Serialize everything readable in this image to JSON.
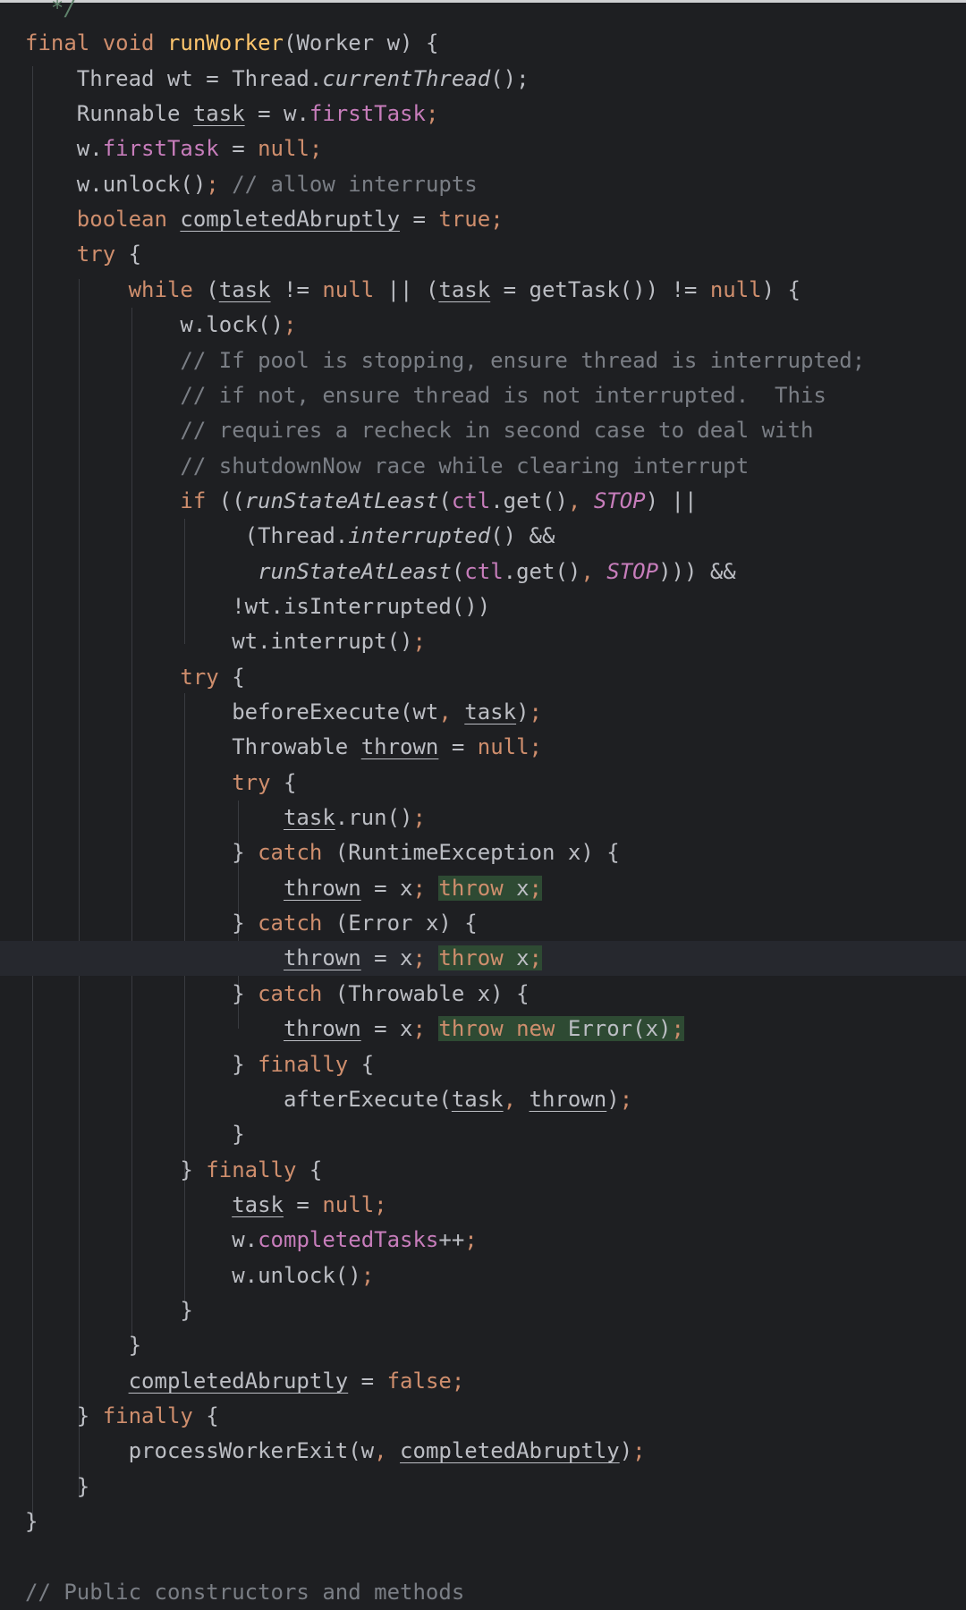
{
  "editor": {
    "lines": [
      [
        {
          "t": "  ",
          "c": ""
        },
        {
          "t": "*/",
          "c": "doc"
        }
      ],
      [
        {
          "t": "final void ",
          "c": "kw"
        },
        {
          "t": "runWorker",
          "c": "mth"
        },
        {
          "t": "(Worker w) {",
          "c": ""
        }
      ],
      [
        {
          "t": "    Thread wt = Thread.",
          "c": ""
        },
        {
          "t": "currentThread",
          "c": "ital"
        },
        {
          "t": "();",
          "c": ""
        }
      ],
      [
        {
          "t": "    Runnable ",
          "c": ""
        },
        {
          "t": "task",
          "c": "var"
        },
        {
          "t": " = w.",
          "c": ""
        },
        {
          "t": "firstTask",
          "c": "fld"
        },
        {
          "t": ";",
          "c": "punc"
        }
      ],
      [
        {
          "t": "    w.",
          "c": ""
        },
        {
          "t": "firstTask",
          "c": "fld"
        },
        {
          "t": " = ",
          "c": ""
        },
        {
          "t": "null",
          "c": "kw"
        },
        {
          "t": ";",
          "c": "punc"
        }
      ],
      [
        {
          "t": "    w.unlock()",
          "c": ""
        },
        {
          "t": ";",
          "c": "punc"
        },
        {
          "t": " // allow interrupts",
          "c": "cmt"
        }
      ],
      [
        {
          "t": "    ",
          "c": ""
        },
        {
          "t": "boolean ",
          "c": "kw"
        },
        {
          "t": "completedAbruptly",
          "c": "var"
        },
        {
          "t": " = ",
          "c": ""
        },
        {
          "t": "true",
          "c": "kw"
        },
        {
          "t": ";",
          "c": "punc"
        }
      ],
      [
        {
          "t": "    ",
          "c": ""
        },
        {
          "t": "try",
          "c": "kw"
        },
        {
          "t": " {",
          "c": ""
        }
      ],
      [
        {
          "t": "        ",
          "c": ""
        },
        {
          "t": "while",
          "c": "kw"
        },
        {
          "t": " (",
          "c": ""
        },
        {
          "t": "task",
          "c": "var"
        },
        {
          "t": " != ",
          "c": ""
        },
        {
          "t": "null",
          "c": "kw"
        },
        {
          "t": " || (",
          "c": ""
        },
        {
          "t": "task",
          "c": "var"
        },
        {
          "t": " = getTask()) != ",
          "c": ""
        },
        {
          "t": "null",
          "c": "kw"
        },
        {
          "t": ") {",
          "c": ""
        }
      ],
      [
        {
          "t": "            w.lock()",
          "c": ""
        },
        {
          "t": ";",
          "c": "punc"
        }
      ],
      [
        {
          "t": "            // If pool is stopping, ensure thread is interrupted;",
          "c": "cmt"
        }
      ],
      [
        {
          "t": "            // if not, ensure thread is not interrupted.  This",
          "c": "cmt"
        }
      ],
      [
        {
          "t": "            // requires a recheck in second case to deal with",
          "c": "cmt"
        }
      ],
      [
        {
          "t": "            // shutdownNow race while clearing interrupt",
          "c": "cmt"
        }
      ],
      [
        {
          "t": "            ",
          "c": ""
        },
        {
          "t": "if",
          "c": "kw"
        },
        {
          "t": " ((",
          "c": ""
        },
        {
          "t": "runStateAtLeast",
          "c": "ital"
        },
        {
          "t": "(",
          "c": ""
        },
        {
          "t": "ctl",
          "c": "fld"
        },
        {
          "t": ".get()",
          "c": ""
        },
        {
          "t": ", ",
          "c": "punc"
        },
        {
          "t": "STOP",
          "c": "fld ital"
        },
        {
          "t": ") ||",
          "c": ""
        }
      ],
      [
        {
          "t": "                 (Thread.",
          "c": ""
        },
        {
          "t": "interrupted",
          "c": "ital"
        },
        {
          "t": "() &&",
          "c": ""
        }
      ],
      [
        {
          "t": "                  ",
          "c": ""
        },
        {
          "t": "runStateAtLeast",
          "c": "ital"
        },
        {
          "t": "(",
          "c": ""
        },
        {
          "t": "ctl",
          "c": "fld"
        },
        {
          "t": ".get()",
          "c": ""
        },
        {
          "t": ", ",
          "c": "punc"
        },
        {
          "t": "STOP",
          "c": "fld ital"
        },
        {
          "t": "))) &&",
          "c": ""
        }
      ],
      [
        {
          "t": "                !wt.isInterrupted())",
          "c": ""
        }
      ],
      [
        {
          "t": "                wt.interrupt()",
          "c": ""
        },
        {
          "t": ";",
          "c": "punc"
        }
      ],
      [
        {
          "t": "            ",
          "c": ""
        },
        {
          "t": "try",
          "c": "kw"
        },
        {
          "t": " {",
          "c": ""
        }
      ],
      [
        {
          "t": "                beforeExecute(wt",
          "c": ""
        },
        {
          "t": ", ",
          "c": "punc"
        },
        {
          "t": "task",
          "c": "var"
        },
        {
          "t": ")",
          "c": ""
        },
        {
          "t": ";",
          "c": "punc"
        }
      ],
      [
        {
          "t": "                Throwable ",
          "c": ""
        },
        {
          "t": "thrown",
          "c": "var"
        },
        {
          "t": " = ",
          "c": ""
        },
        {
          "t": "null",
          "c": "kw"
        },
        {
          "t": ";",
          "c": "punc"
        }
      ],
      [
        {
          "t": "                ",
          "c": ""
        },
        {
          "t": "try",
          "c": "kw"
        },
        {
          "t": " {",
          "c": ""
        }
      ],
      [
        {
          "t": "                    ",
          "c": ""
        },
        {
          "t": "task",
          "c": "var"
        },
        {
          "t": ".run()",
          "c": ""
        },
        {
          "t": ";",
          "c": "punc"
        }
      ],
      [
        {
          "t": "                } ",
          "c": ""
        },
        {
          "t": "catch",
          "c": "kw"
        },
        {
          "t": " (RuntimeException x) {",
          "c": ""
        }
      ],
      [
        {
          "t": "                    ",
          "c": ""
        },
        {
          "t": "thrown",
          "c": "var"
        },
        {
          "t": " = x",
          "c": ""
        },
        {
          "t": "; ",
          "c": "punc"
        },
        {
          "t": "throw",
          "c": "kw hl"
        },
        {
          "t": " x",
          "c": "hl"
        },
        {
          "t": ";",
          "c": "punc hl"
        }
      ],
      [
        {
          "t": "                } ",
          "c": ""
        },
        {
          "t": "catch",
          "c": "kw"
        },
        {
          "t": " (Error x) {",
          "c": ""
        }
      ],
      [
        {
          "t": "                    ",
          "c": ""
        },
        {
          "t": "thrown",
          "c": "var"
        },
        {
          "t": " = x",
          "c": ""
        },
        {
          "t": "; ",
          "c": "punc"
        },
        {
          "t": "throw",
          "c": "kw hl"
        },
        {
          "t": " x",
          "c": "hl"
        },
        {
          "t": ";",
          "c": "punc hl"
        }
      ],
      [
        {
          "t": "                } ",
          "c": ""
        },
        {
          "t": "catch",
          "c": "kw"
        },
        {
          "t": " (Throwable x) {",
          "c": ""
        }
      ],
      [
        {
          "t": "                    ",
          "c": ""
        },
        {
          "t": "thrown",
          "c": "var"
        },
        {
          "t": " = x",
          "c": ""
        },
        {
          "t": "; ",
          "c": "punc"
        },
        {
          "t": "throw new",
          "c": "kw hl"
        },
        {
          "t": " Error(x)",
          "c": "hl"
        },
        {
          "t": ";",
          "c": "punc hl"
        }
      ],
      [
        {
          "t": "                } ",
          "c": ""
        },
        {
          "t": "finally",
          "c": "kw"
        },
        {
          "t": " {",
          "c": ""
        }
      ],
      [
        {
          "t": "                    afterExecute(",
          "c": ""
        },
        {
          "t": "task",
          "c": "var"
        },
        {
          "t": ", ",
          "c": "punc"
        },
        {
          "t": "thrown",
          "c": "var"
        },
        {
          "t": ")",
          "c": ""
        },
        {
          "t": ";",
          "c": "punc"
        }
      ],
      [
        {
          "t": "                }",
          "c": ""
        }
      ],
      [
        {
          "t": "            } ",
          "c": ""
        },
        {
          "t": "finally",
          "c": "kw"
        },
        {
          "t": " {",
          "c": ""
        }
      ],
      [
        {
          "t": "                ",
          "c": ""
        },
        {
          "t": "task",
          "c": "var"
        },
        {
          "t": " = ",
          "c": ""
        },
        {
          "t": "null",
          "c": "kw"
        },
        {
          "t": ";",
          "c": "punc"
        }
      ],
      [
        {
          "t": "                w.",
          "c": ""
        },
        {
          "t": "completedTasks",
          "c": "fld"
        },
        {
          "t": "++",
          "c": ""
        },
        {
          "t": ";",
          "c": "punc"
        }
      ],
      [
        {
          "t": "                w.unlock()",
          "c": ""
        },
        {
          "t": ";",
          "c": "punc"
        }
      ],
      [
        {
          "t": "            }",
          "c": ""
        }
      ],
      [
        {
          "t": "        }",
          "c": ""
        }
      ],
      [
        {
          "t": "        ",
          "c": ""
        },
        {
          "t": "completedAbruptly",
          "c": "var"
        },
        {
          "t": " = ",
          "c": ""
        },
        {
          "t": "false",
          "c": "kw"
        },
        {
          "t": ";",
          "c": "punc"
        }
      ],
      [
        {
          "t": "    } ",
          "c": ""
        },
        {
          "t": "finally",
          "c": "kw"
        },
        {
          "t": " {",
          "c": ""
        }
      ],
      [
        {
          "t": "        processWorkerExit(w",
          "c": ""
        },
        {
          "t": ", ",
          "c": "punc"
        },
        {
          "t": "completedAbruptly",
          "c": "var"
        },
        {
          "t": ")",
          "c": ""
        },
        {
          "t": ";",
          "c": "punc"
        }
      ],
      [
        {
          "t": "    }",
          "c": ""
        }
      ],
      [
        {
          "t": "}",
          "c": ""
        }
      ],
      [
        {
          "t": "",
          "c": ""
        }
      ],
      [
        {
          "t": "// Public constructors and methods",
          "c": "cmt"
        }
      ]
    ],
    "current_line": 27
  }
}
